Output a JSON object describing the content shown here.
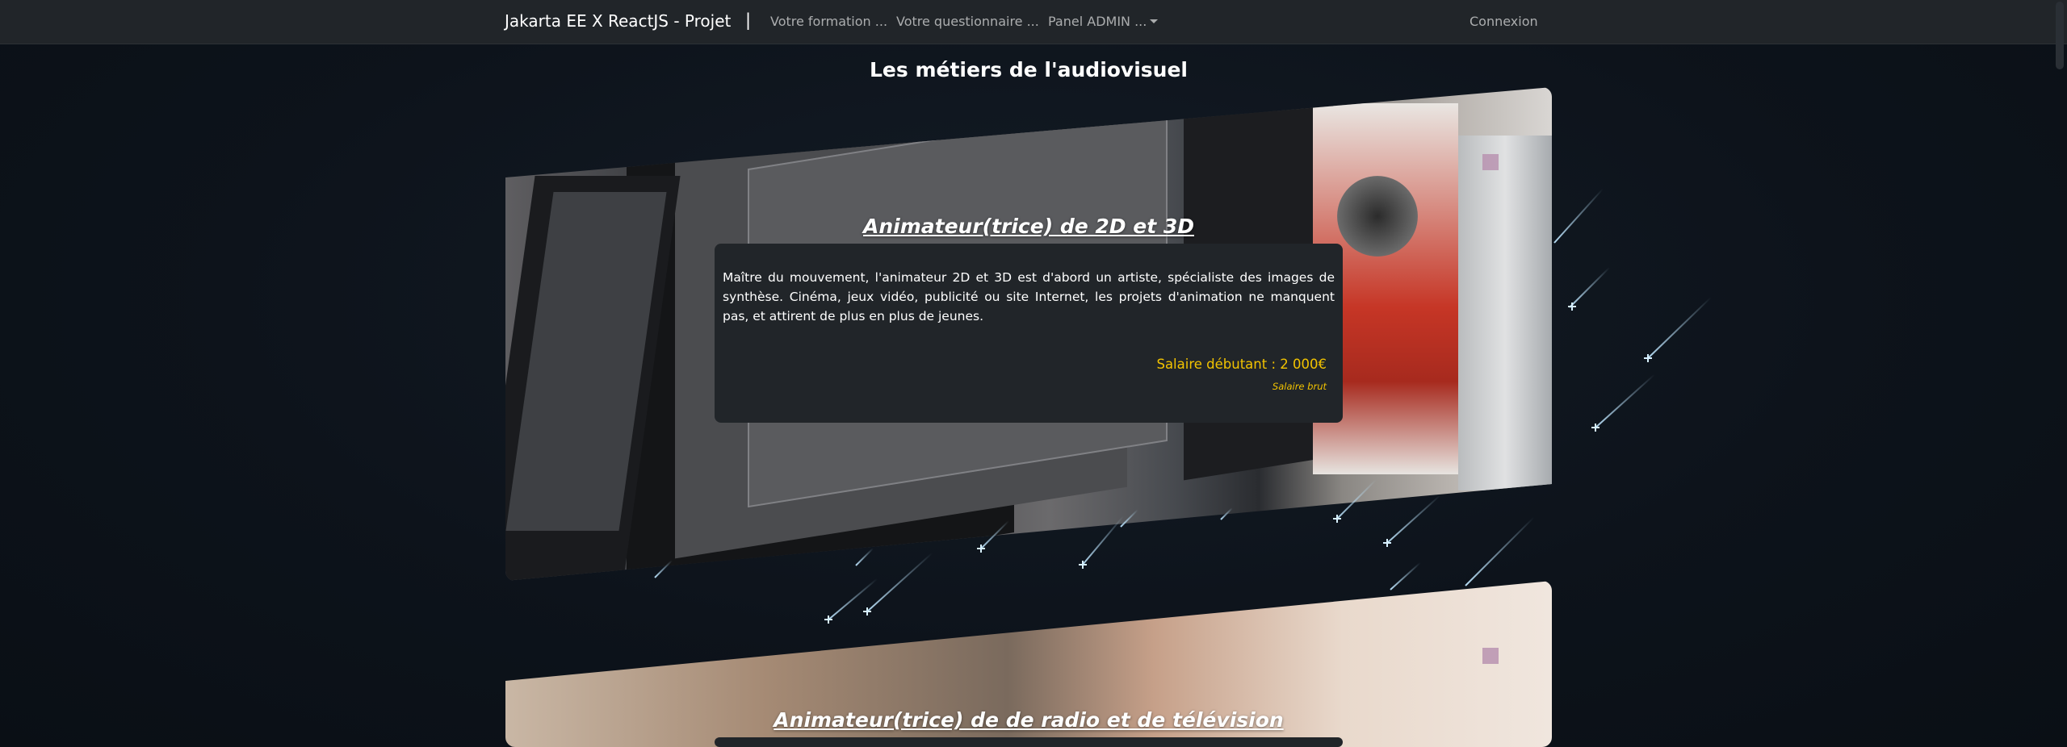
{
  "navbar": {
    "brand": "Jakarta EE X ReactJS - Projet",
    "brand_separator": "|",
    "links": [
      "Votre formation ...",
      "Votre questionnaire ...",
      "Panel ADMIN ..."
    ],
    "login": "Connexion"
  },
  "page": {
    "title": "Les métiers de l'audiovisuel"
  },
  "cards": [
    {
      "title": "Animateur(trice) de 2D et 3D",
      "description": "Maître du mouvement, l'animateur 2D et 3D est d'abord un artiste, spécialiste des images de synthèse. Cinéma, jeux vidéo, publicité ou site Internet, les projets d'animation ne manquent pas, et attirent de plus en plus de jeunes.",
      "salary": "Salaire débutant : 2 000€",
      "salary_note": "Salaire brut"
    },
    {
      "title": "Animateur(trice) de de radio et de télévision"
    }
  ],
  "colors": {
    "navbar_bg": "#212529",
    "info_box_bg": "#212529",
    "salary": "#f2c300",
    "page_bg": "#0d131b"
  }
}
